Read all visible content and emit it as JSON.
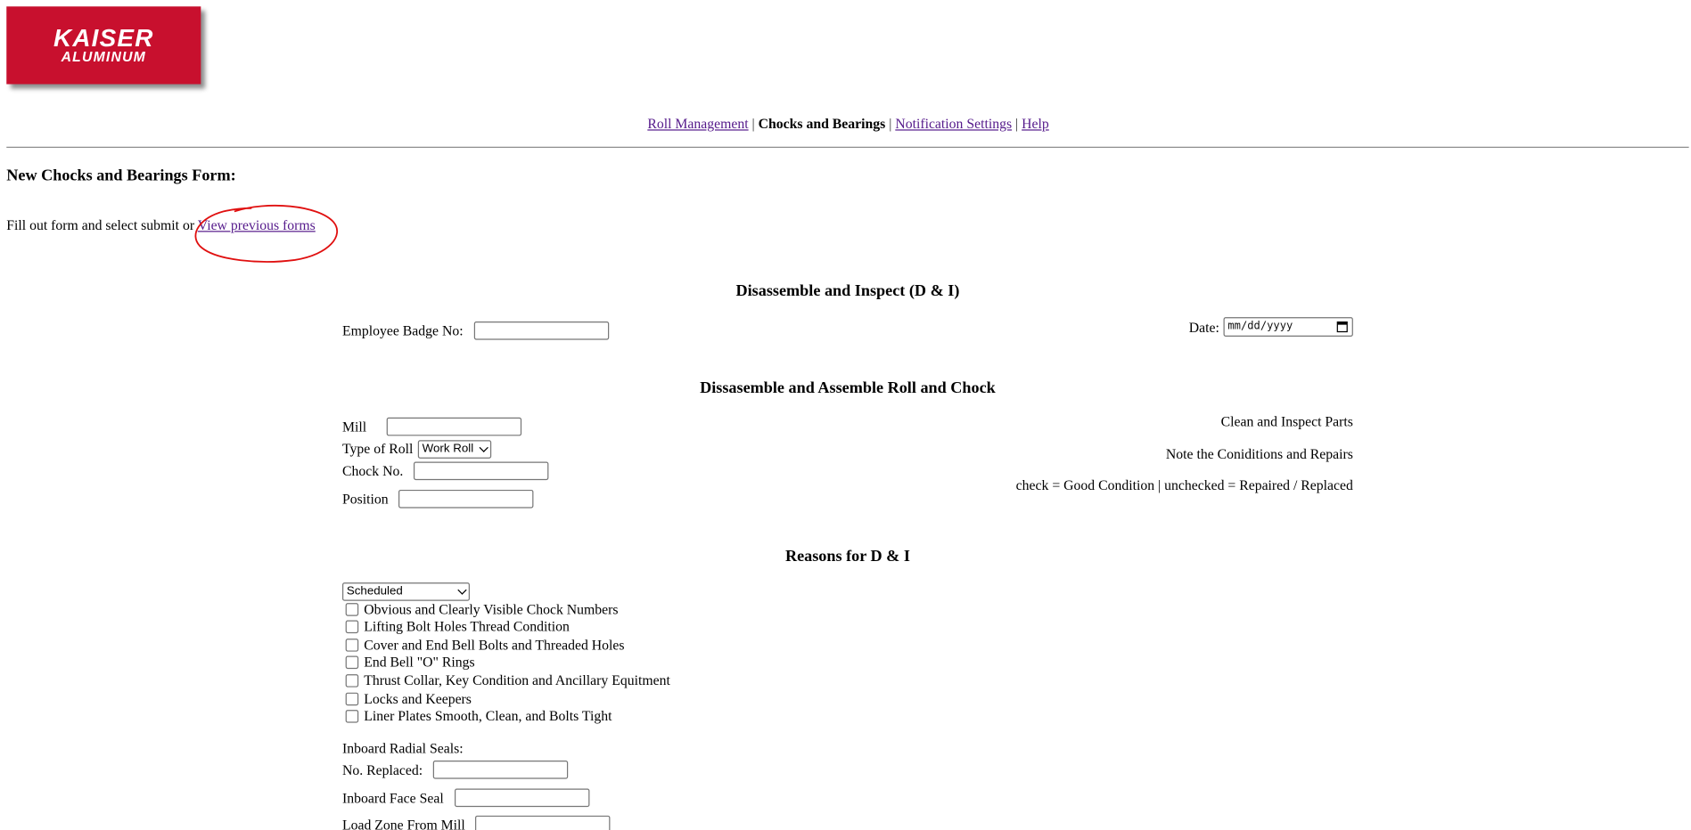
{
  "logo": {
    "main": "KAISER",
    "sub": "ALUMINUM"
  },
  "nav": {
    "items": [
      "Roll Management",
      "Chocks and Bearings",
      "Notification Settings",
      "Help"
    ],
    "separator": "|",
    "current": "Chocks and Bearings"
  },
  "page": {
    "title": "New Chocks and Bearings Form:",
    "intro_text": "Fill out form and select submit or",
    "intro_link": "View previous forms"
  },
  "section1": {
    "title": "Disassemble and Inspect (D & I)",
    "badge_label": "Employee Badge No:",
    "badge_value": "",
    "date_label": "Date:",
    "date_placeholder": "mm/dd/yyyy"
  },
  "section2": {
    "title": "Dissasemble and Assemble Roll and Chock",
    "mill_label": "Mill",
    "type_label": "Type of Roll",
    "type_value": "Work Roll",
    "chock_label": "Chock No.",
    "position_label": "Position",
    "right_line1": "Clean and Inspect Parts",
    "right_line2": "Note the Coniditions and Repairs",
    "right_line3": "check = Good Condition | unchecked = Repaired / Replaced"
  },
  "section3": {
    "title": "Reasons for D & I",
    "reason_value": "Scheduled",
    "checks": [
      "Obvious and Clearly Visible Chock Numbers",
      "Lifting Bolt Holes Thread Condition",
      "Cover and End Bell Bolts and Threaded Holes",
      "End Bell \"O\" Rings",
      "Thrust Collar, Key Condition and Ancillary Equitment",
      "Locks and Keepers",
      "Liner Plates Smooth, Clean, and Bolts Tight"
    ],
    "inboard_radial_label": "Inboard Radial Seals:",
    "no_replaced_label": "No. Replaced:",
    "inboard_face_label": "Inboard Face Seal",
    "load_zone_label": "Load Zone From Mill"
  },
  "colors": {
    "brand_red": "#c8102e",
    "link_visited": "#551a8b",
    "annotation_red": "#e01010"
  }
}
